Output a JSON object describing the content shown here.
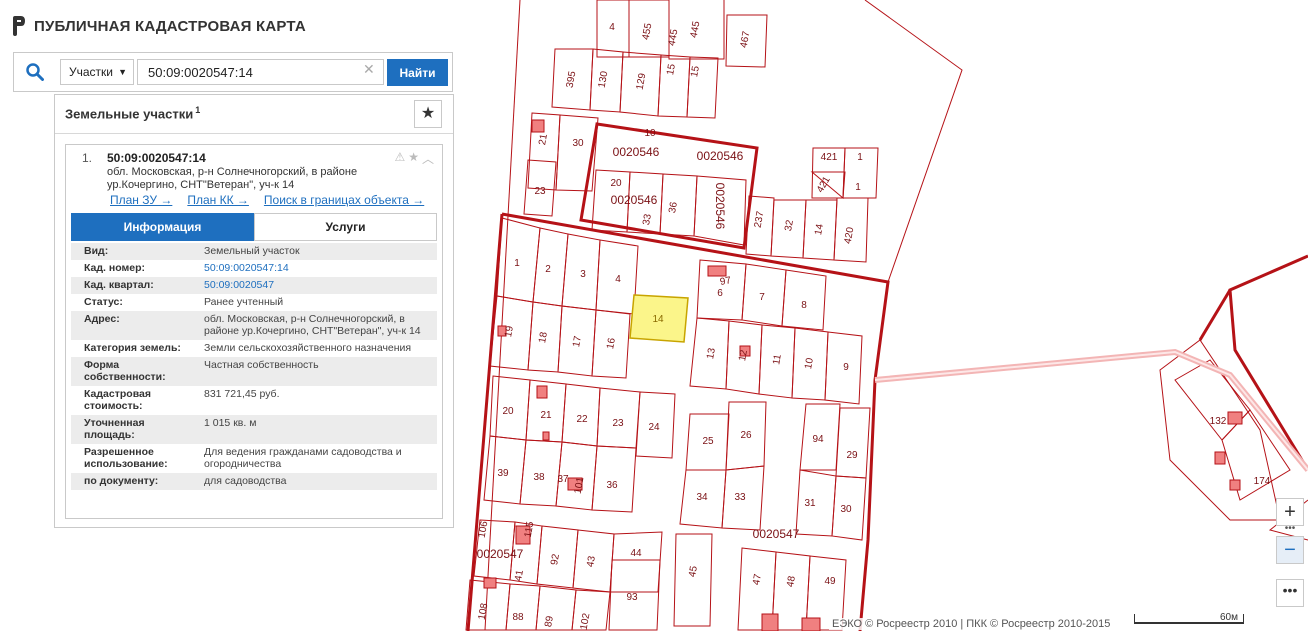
{
  "app": {
    "title": "ПУБЛИЧНАЯ КАДАСТРОВАЯ КАРТА"
  },
  "search": {
    "type_label": "Участки",
    "value": "50:09:0020547:14",
    "button": "Найти"
  },
  "panel": {
    "title": "Земельные участки",
    "count": "1",
    "result": {
      "num": "1.",
      "cad": "50:09:0020547:14",
      "address": "обл. Московская, р-н Солнечногорский, в районе ур.Кочергино, СНТ\"Ветеран\", уч-к 14"
    },
    "links": [
      "План ЗУ →",
      "План КК →",
      "Поиск в границах объекта →"
    ],
    "tabs": [
      "Информация",
      "Услуги"
    ],
    "info": [
      {
        "k": "Вид:",
        "v": "Земельный участок"
      },
      {
        "k": "Кад. номер:",
        "v": "50:09:0020547:14"
      },
      {
        "k": "Кад. квартал:",
        "v": "50:09:0020547"
      },
      {
        "k": "Статус:",
        "v": "Ранее учтенный"
      },
      {
        "k": "Адрес:",
        "v": "обл. Московская, р-н Солнечногорский, в районе ур.Кочергино, СНТ\"Ветеран\", уч-к 14"
      },
      {
        "k": "Категория земель:",
        "v": "Земли сельскохозяйственного назначения"
      },
      {
        "k": "Форма собственности:",
        "v": "Частная собственность"
      },
      {
        "k": "Кадастровая стоимость:",
        "v": "831 721,45 руб."
      },
      {
        "k": "Уточненная площадь:",
        "v": "1 015 кв. м"
      },
      {
        "k": "Разрешенное использование:",
        "v": "Для ведения гражданами садоводства и огородничества"
      },
      {
        "k": "по документу:",
        "v": "для садоводства"
      }
    ]
  },
  "map": {
    "labels": {
      "p4": "4",
      "p455": "455",
      "p445a": "445",
      "p445b": "445",
      "p467": "467",
      "p395": "395",
      "p130": "130",
      "p129": "129",
      "p15a": "15",
      "p15b": "15",
      "p21a": "21",
      "p30a": "30",
      "p10": "10",
      "q546a": "0020546",
      "q546b": "0020546",
      "p421a": "421",
      "p1a": "1",
      "p23a": "23",
      "p20a": "20",
      "q546c": "0020546",
      "p33a": "33",
      "p36a": "36",
      "q546d": "0020546",
      "p421b": "421",
      "p1b": "1",
      "p237": "237",
      "p32": "32",
      "p14a": "14",
      "p420": "420",
      "s1": "1",
      "s2": "2",
      "s3": "3",
      "s4": "4",
      "s14": "14",
      "s97": "97",
      "s6": "6",
      "s7": "7",
      "s8": "8",
      "s19": "19",
      "s18": "18",
      "s17": "17",
      "s16": "16",
      "s13": "13",
      "s12": "12",
      "s11": "11",
      "s10": "10",
      "s9": "9",
      "s20": "20",
      "s21": "21",
      "s22": "22",
      "s23": "23",
      "s24": "24",
      "s25": "25",
      "s26": "26",
      "s94": "94",
      "s29": "29",
      "s39": "39",
      "s38": "38",
      "s37": "37",
      "s101": "101",
      "s36": "36",
      "s34": "34",
      "s33": "33",
      "s31": "31",
      "s30": "30",
      "s106": "106",
      "s115": "115",
      "q547a": "0020547",
      "q547b": "0020547",
      "s41": "41",
      "s92": "92",
      "s43": "43",
      "s44": "44",
      "s45": "45",
      "s47": "47",
      "s48": "48",
      "s49": "49",
      "s93": "93",
      "s108": "108",
      "s88": "88",
      "s89": "89",
      "s102": "102",
      "r132": "132",
      "r174": "174"
    }
  },
  "map_controls": {
    "zoom_in": "+",
    "zoom_out": "−",
    "dots": "•••",
    "more": "•••"
  },
  "footer": {
    "text": "ЕЭКО © Росреестр 2010 | ПКК © Росреестр 2010-2015",
    "scale": "60м"
  },
  "colors": {
    "accent": "#1e6fbf",
    "parcel_line": "#b51217",
    "highlight_fill": "#fbf58a",
    "building_fill": "#f08080"
  }
}
